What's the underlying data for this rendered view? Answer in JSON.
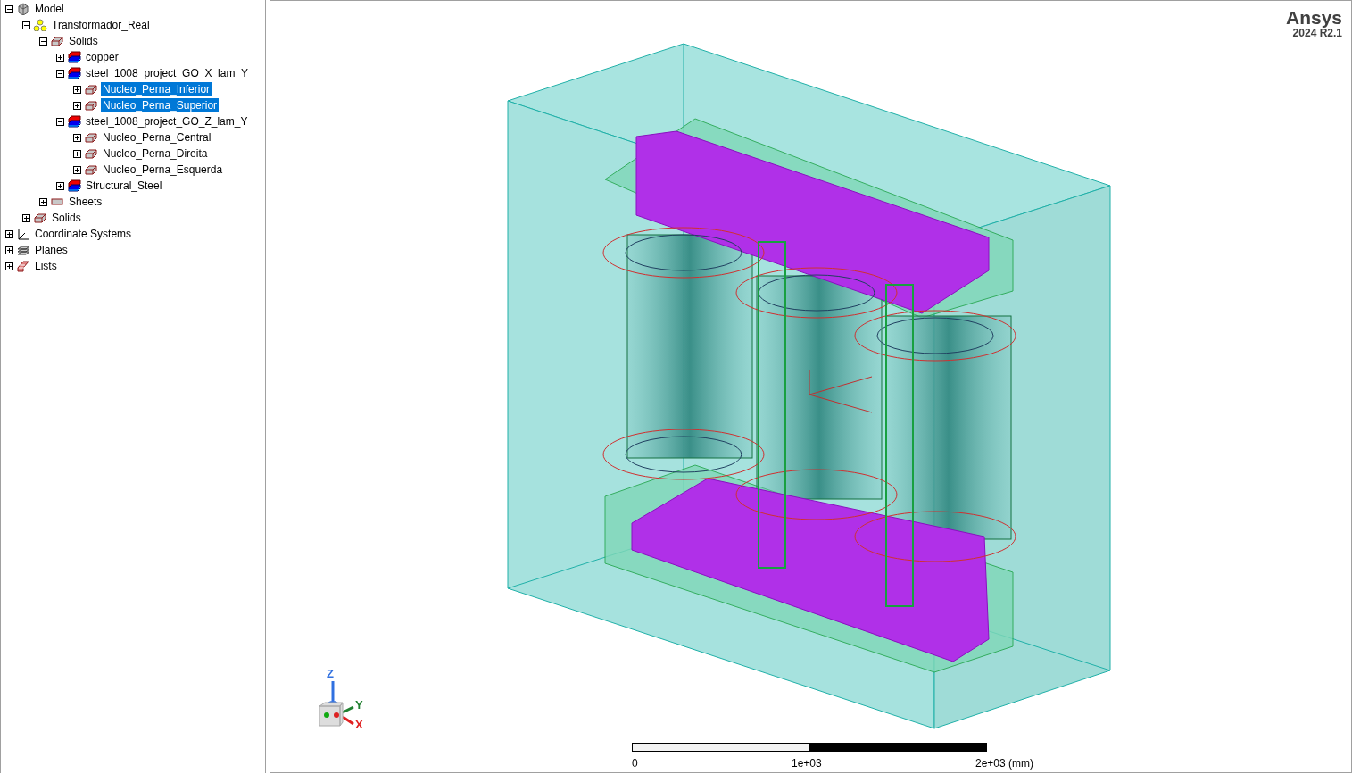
{
  "tree": [
    {
      "label": "Model",
      "kind": "model",
      "expanded": true,
      "selected": false,
      "children": [
        {
          "label": "Transformador_Real",
          "kind": "geometry",
          "expanded": true,
          "selected": false,
          "children": [
            {
              "label": "Solids",
              "kind": "solid",
              "expanded": true,
              "selected": false,
              "children": [
                {
                  "label": "copper",
                  "kind": "material",
                  "expanded": false,
                  "selected": false
                },
                {
                  "label": "steel_1008_project_GO_X_lam_Y",
                  "kind": "material",
                  "expanded": true,
                  "selected": false,
                  "children": [
                    {
                      "label": "Nucleo_Perna_Inferior",
                      "kind": "solid",
                      "expanded": false,
                      "selected": true
                    },
                    {
                      "label": "Nucleo_Perna_Superior",
                      "kind": "solid",
                      "expanded": false,
                      "selected": true
                    }
                  ]
                },
                {
                  "label": "steel_1008_project_GO_Z_lam_Y",
                  "kind": "material",
                  "expanded": true,
                  "selected": false,
                  "children": [
                    {
                      "label": "Nucleo_Perna_Central",
                      "kind": "solid",
                      "expanded": false,
                      "selected": false
                    },
                    {
                      "label": "Nucleo_Perna_Direita",
                      "kind": "solid",
                      "expanded": false,
                      "selected": false
                    },
                    {
                      "label": "Nucleo_Perna_Esquerda",
                      "kind": "solid",
                      "expanded": false,
                      "selected": false
                    }
                  ]
                },
                {
                  "label": "Structural_Steel",
                  "kind": "material",
                  "expanded": false,
                  "selected": false
                }
              ]
            },
            {
              "label": "Sheets",
              "kind": "sheet",
              "expanded": false,
              "selected": false
            }
          ]
        },
        {
          "label": "Solids",
          "kind": "solid",
          "expanded": false,
          "selected": false
        }
      ]
    },
    {
      "label": "Coordinate Systems",
      "kind": "coords",
      "expanded": false,
      "selected": false
    },
    {
      "label": "Planes",
      "kind": "planes",
      "expanded": false,
      "selected": false
    },
    {
      "label": "Lists",
      "kind": "lists",
      "expanded": false,
      "selected": false
    }
  ],
  "viewport": {
    "logo": "Ansys",
    "version": "2024 R2.1",
    "triad": {
      "z": "Z",
      "y": "Y",
      "x": "X"
    },
    "scale_bar": {
      "labels": [
        "0",
        "1e+03",
        "2e+03 (mm)"
      ]
    }
  }
}
